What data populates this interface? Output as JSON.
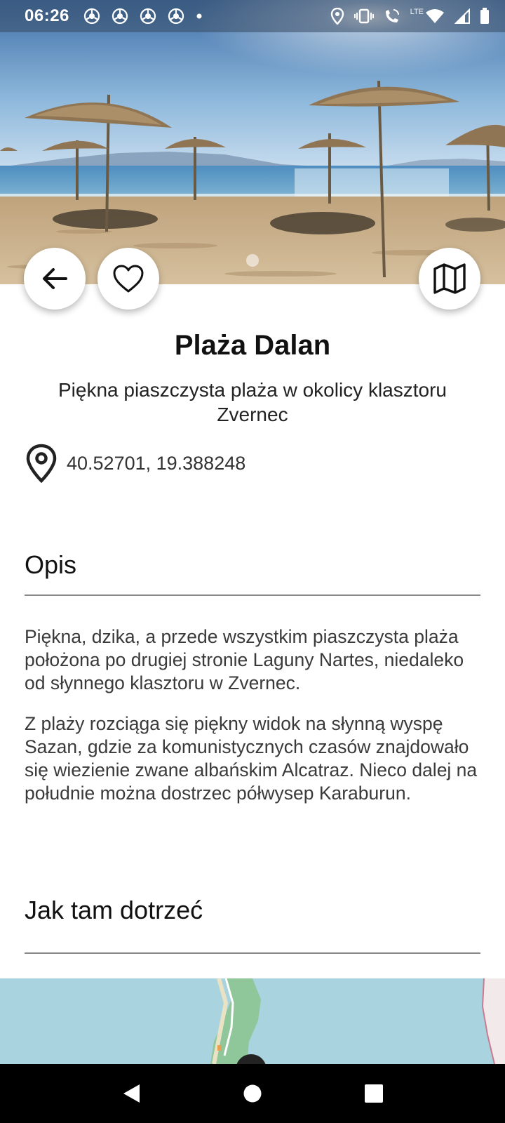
{
  "status_bar": {
    "time": "06:26",
    "network_label": "LTE",
    "notification_icons": [
      "chrome-icon",
      "chrome-icon",
      "chrome-icon",
      "chrome-icon",
      "dot-icon"
    ],
    "system_icons": [
      "location-icon",
      "vibrate-icon",
      "wifi-call-icon",
      "wifi-icon",
      "signal-icon",
      "battery-icon"
    ]
  },
  "hero": {
    "image_description": "sandy beach with straw umbrellas",
    "page_indicator_count": 1,
    "page_indicator_active": 0
  },
  "actions": {
    "back_icon": "arrow-left-icon",
    "favorite_icon": "heart-icon",
    "map_icon": "map-icon"
  },
  "place": {
    "title": "Plaża Dalan",
    "subtitle": "Piękna piaszczysta plaża w okolicy klasztoru Zvernec",
    "coordinates": "40.52701, 19.388248"
  },
  "description": {
    "heading": "Opis",
    "paragraphs": [
      "Piękna, dzika, a przede wszystkim piaszczysta plaża położona po drugiej stronie Laguny Nartes, niedaleko od słynnego klasztoru w Zvernec.",
      "Z plaży rozciąga się piękny widok na słynną wyspę Sazan, gdzie za komunistycznych czasów znajdowało się wiezienie zwane albańskim Alcatraz. Nieco dalej na południe można dostrzec półwysep Karaburun."
    ]
  },
  "directions": {
    "heading": "Jak tam dotrzeć"
  },
  "colors": {
    "sky_top": "#3f6fa8",
    "sea": "#5d9cc4",
    "sand": "#c9b08a",
    "map_water": "#a9d3df",
    "map_land": "#8fc79a"
  },
  "navbar": {
    "back_icon": "nav-back-icon",
    "home_icon": "nav-home-icon",
    "recents_icon": "nav-recents-icon"
  }
}
